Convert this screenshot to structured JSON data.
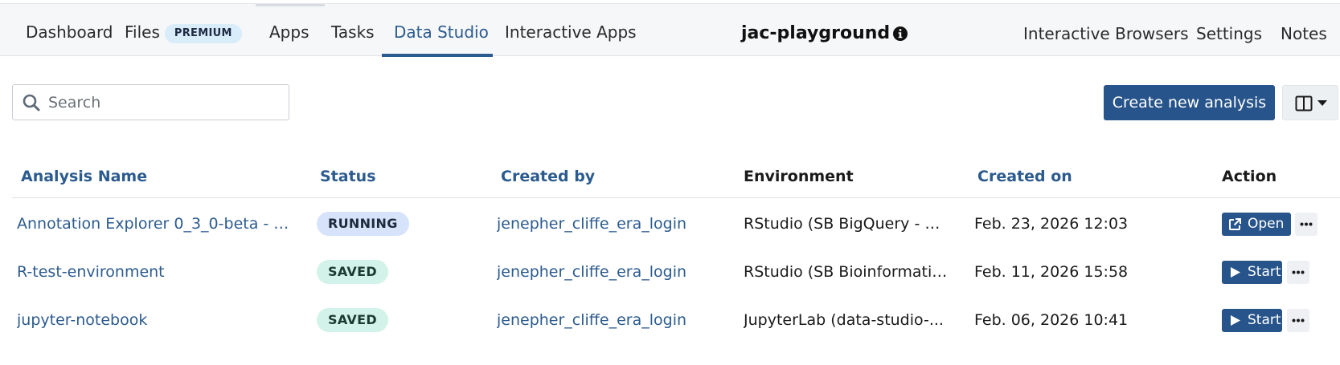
{
  "nav": {
    "items": [
      {
        "label": "Dashboard",
        "active": false
      },
      {
        "label": "Files",
        "active": false,
        "badge": "PREMIUM"
      },
      {
        "label": "Apps",
        "active": false
      },
      {
        "label": "Tasks",
        "active": false
      },
      {
        "label": "Data Studio",
        "active": true
      },
      {
        "label": "Interactive Apps",
        "active": false
      }
    ],
    "project_title": "jac-playground",
    "right_items": [
      {
        "label": "Interactive Browsers"
      },
      {
        "label": "Settings"
      },
      {
        "label": "Notes"
      }
    ]
  },
  "toolbar": {
    "search_placeholder": "Search",
    "search_value": "",
    "create_label": "Create new analysis"
  },
  "table": {
    "headers": {
      "name": "Analysis Name",
      "status": "Status",
      "created_by": "Created by",
      "environment": "Environment",
      "created_on": "Created on",
      "action": "Action"
    },
    "rows": [
      {
        "name": "Annotation Explorer 0_3_0-beta - L...",
        "status": "RUNNING",
        "created_by": "jenepher_cliffe_era_login",
        "environment": "RStudio (SB BigQuery - R...",
        "created_on": "Feb. 23, 2026 12:03",
        "action": "Open"
      },
      {
        "name": "R-test-environment",
        "status": "SAVED",
        "created_by": "jenepher_cliffe_era_login",
        "environment": "RStudio (SB Bioinformatic...",
        "created_on": "Feb. 11, 2026 15:58",
        "action": "Start"
      },
      {
        "name": "jupyter-notebook",
        "status": "SAVED",
        "created_by": "jenepher_cliffe_era_login",
        "environment": "JupyterLab (data-studio-...",
        "created_on": "Feb. 06, 2026 10:41",
        "action": "Start"
      }
    ]
  },
  "colors": {
    "accent": "#2c5b8f",
    "primary_button": "#27548a",
    "running_badge": "#d6e3fb",
    "saved_badge": "#d3f3ea"
  },
  "icons": {
    "info": "info-icon",
    "search": "search-icon",
    "columns": "columns-icon",
    "open": "external-link-icon",
    "start": "play-icon",
    "more": "more-horizontal-icon"
  }
}
